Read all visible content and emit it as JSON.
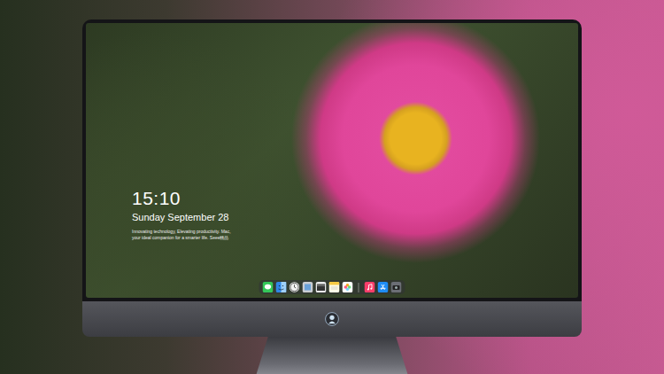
{
  "lock_screen": {
    "time": "15:10",
    "date": "Sunday September 28",
    "tagline": "Innovating technology, Elevating productivity. Mac, your ideal companion for a smarter life. Seee精品"
  },
  "dock": {
    "apps": [
      {
        "kind": "messages"
      },
      {
        "kind": "finder"
      },
      {
        "kind": "clock"
      },
      {
        "kind": "preview"
      },
      {
        "kind": "clapper"
      },
      {
        "kind": "notes"
      },
      {
        "kind": "photos"
      },
      {
        "kind": "separator"
      },
      {
        "kind": "music"
      },
      {
        "kind": "appstore"
      },
      {
        "kind": "camera"
      }
    ]
  }
}
